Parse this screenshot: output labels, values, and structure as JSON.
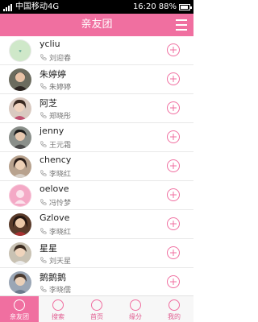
{
  "status": {
    "carrier": "中国移动4G",
    "time": "16:20",
    "battery": "88%"
  },
  "header": {
    "title": "亲友团"
  },
  "contacts": [
    {
      "name": "ycliu",
      "contact": "刘迎春",
      "avatar": "ycliu-avatar"
    },
    {
      "name": "朱婷婷",
      "contact": "朱婷婷",
      "avatar": "photo-avatar"
    },
    {
      "name": "阿芝",
      "contact": "郑晓彤",
      "avatar": "photo-avatar"
    },
    {
      "name": "jenny",
      "contact": "王元霜",
      "avatar": "photo-avatar"
    },
    {
      "name": "chency",
      "contact": "李晓红",
      "avatar": "photo-avatar"
    },
    {
      "name": "oelove",
      "contact": "冯怜梦",
      "avatar": "pink-avatar"
    },
    {
      "name": "Gzlove",
      "contact": "李晓红",
      "avatar": "photo-avatar"
    },
    {
      "name": "星星",
      "contact": "刘天星",
      "avatar": "photo-avatar"
    },
    {
      "name": "鹅鹅鹅",
      "contact": "李晓儒",
      "avatar": "photo-avatar"
    }
  ],
  "tabs": [
    {
      "label": "亲友团",
      "icon": "group-icon"
    },
    {
      "label": "搜索",
      "icon": "search-icon"
    },
    {
      "label": "首页",
      "icon": "home-icon"
    },
    {
      "label": "缘分",
      "icon": "couple-icon"
    },
    {
      "label": "我的",
      "icon": "profile-icon"
    }
  ],
  "colors": {
    "accent": "#f06fa0"
  }
}
